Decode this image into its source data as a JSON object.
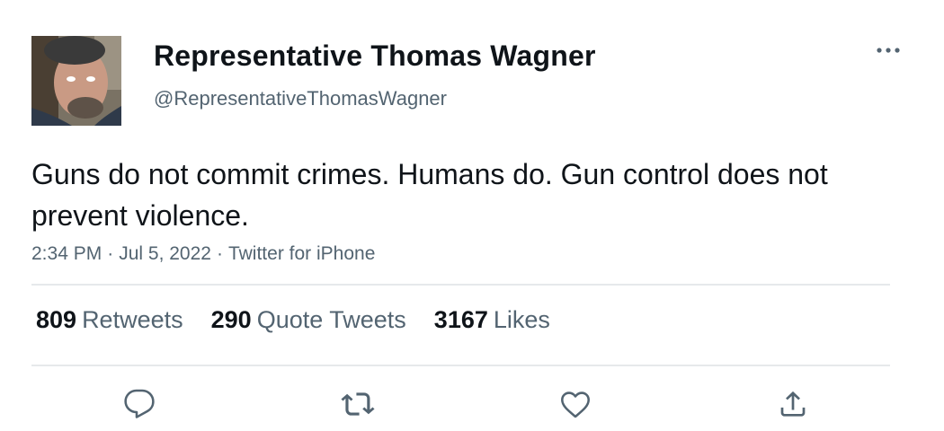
{
  "author": {
    "display_name": "Representative Thomas Wagner",
    "handle": "@RepresentativeThomasWagner",
    "avatar_icon": "profile-photo"
  },
  "tweet": {
    "text": "Guns do not commit crimes. Humans do. Gun control does not prevent violence.",
    "time": "2:34 PM",
    "separator": "·",
    "date": "Jul 5, 2022",
    "source": "Twitter for iPhone"
  },
  "stats": {
    "retweets": {
      "count": "809",
      "label": "Retweets"
    },
    "quote_tweets": {
      "count": "290",
      "label": "Quote Tweets"
    },
    "likes": {
      "count": "3167",
      "label": "Likes"
    }
  },
  "actions": {
    "reply_icon": "reply-icon",
    "retweet_icon": "retweet-icon",
    "like_icon": "heart-icon",
    "share_icon": "share-icon",
    "more_icon": "more-icon"
  },
  "colors": {
    "text": "#0f1419",
    "secondary": "#536471",
    "divider": "#e6e9eb"
  }
}
